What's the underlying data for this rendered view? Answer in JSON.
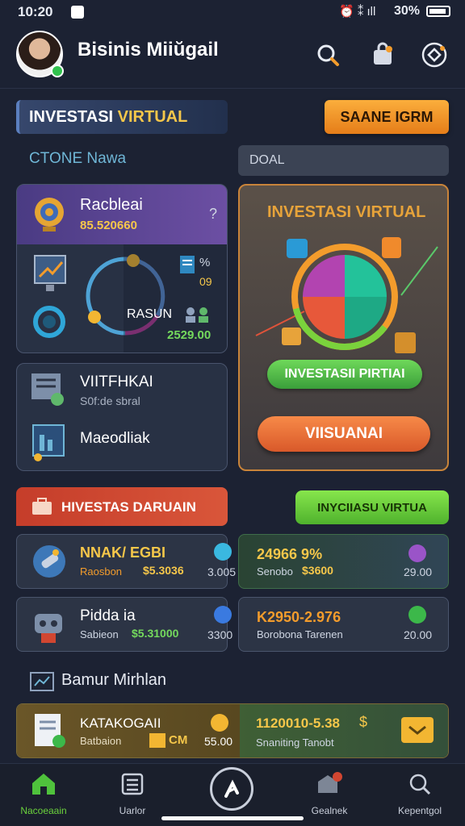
{
  "status_bar": {
    "time": "10:20",
    "battery": "30%"
  },
  "header": {
    "title": "Bisinis Miiŭgail"
  },
  "section1": {
    "banner_part1": "INVESTASI ",
    "banner_part2": "VIRTUAL",
    "button_label": "SAANE IGRM",
    "sub_label": "CTONE Nawa",
    "goal_input": "DOAL"
  },
  "card_a": {
    "title": "Racbleai",
    "value": "85.520660",
    "question": "?",
    "label_pct": "%",
    "label_09": "09",
    "center_label": "RASUN",
    "center_value": "2529.00"
  },
  "card_b": {
    "item1_title": "VIITFHKAI",
    "item1_sub": "S0f:de sbral",
    "item2_title": "Maeodliak"
  },
  "card_c": {
    "title": "INVESTASI VIRTUAL",
    "green_button": "INVESTASII PIRTIAI",
    "orange_button": "VIISUANAI"
  },
  "section2": {
    "banner": "HIVESTAS DARUAIN",
    "green_button": "INYCIIASU VIRTUA",
    "rows": [
      {
        "title": "NNAK/ EGBI",
        "sub": "Raosbon",
        "value": "$5.3036",
        "right": "3.005"
      },
      {
        "title": "24966 9%",
        "sub": "Senobo",
        "value": "$3600",
        "right": "29.00"
      },
      {
        "title": "Pidda ia",
        "sub": "Sabieon",
        "value": "$5.31000",
        "right": "3300"
      },
      {
        "title": "K2950-2.976",
        "sub": "Borobona Tarenen",
        "value": "",
        "right": "20.00"
      }
    ]
  },
  "section3": {
    "title": "Bamur Mirhlan",
    "left_title": "KATAKOGAII",
    "left_sub": "Batbaion",
    "left_badge": "CM",
    "left_value": "55.00",
    "right_title": "1120010-5.38",
    "right_sub": "Snaniting Tanobt"
  },
  "nav": {
    "items": [
      "Nacoeaain",
      "Uarlor",
      "",
      "Gealnek",
      "Kepentgol"
    ]
  },
  "colors": {
    "accent_orange": "#f39c2c",
    "accent_green": "#6bd23c",
    "accent_red": "#d14631"
  }
}
